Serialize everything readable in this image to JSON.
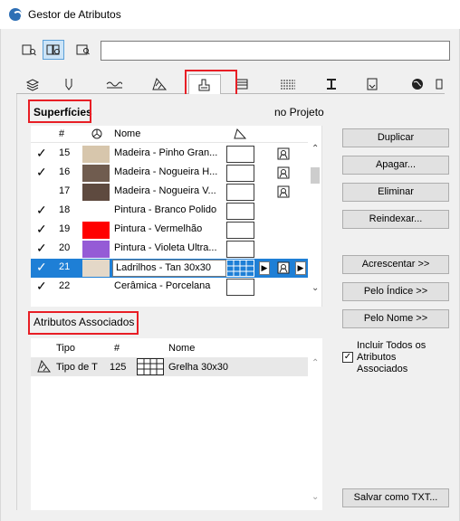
{
  "window": {
    "title": "Gestor de Atributos"
  },
  "search": {
    "value": ""
  },
  "tabs": [
    {
      "icon": "layers-icon"
    },
    {
      "icon": "pen-icon"
    },
    {
      "icon": "line-type-icon"
    },
    {
      "icon": "fill-icon"
    },
    {
      "icon": "surface-icon",
      "selected": true
    },
    {
      "icon": "composite-icon"
    },
    {
      "icon": "profile-icon"
    },
    {
      "icon": "building-material-icon"
    },
    {
      "icon": "zone-icon"
    },
    {
      "icon": "mep-icon"
    },
    {
      "icon": "globe-icon"
    }
  ],
  "surfaces": {
    "section_label": "Superfícies",
    "in_project_label": "no Projeto",
    "columns": {
      "num": "#",
      "name": "Nome"
    },
    "rows": [
      {
        "checked": true,
        "num": "15",
        "color": "#d7c6ac",
        "name": "Madeira - Pinho Gran...",
        "in_project": true
      },
      {
        "checked": true,
        "num": "16",
        "color": "#705c4f",
        "name": "Madeira - Nogueira H...",
        "in_project": true
      },
      {
        "checked": false,
        "num": "17",
        "color": "#5e4a3f",
        "name": "Madeira - Nogueira V...",
        "in_project": true
      },
      {
        "checked": true,
        "num": "18",
        "color": "#ffffff",
        "name": "Pintura - Branco Polido",
        "in_project": false
      },
      {
        "checked": true,
        "num": "19",
        "color": "#ff0000",
        "name": "Pintura - Vermelhão",
        "in_project": false
      },
      {
        "checked": true,
        "num": "20",
        "color": "#955bd6",
        "name": "Pintura - Violeta Ultra...",
        "in_project": false
      },
      {
        "checked": true,
        "num": "21",
        "color": "#e4d8c8",
        "name": "Ladrilhos - Tan 30x30",
        "in_project": true,
        "selected": true
      },
      {
        "checked": true,
        "num": "22",
        "color": "#ffffff",
        "name": "Cerâmica - Porcelana",
        "in_project": false
      }
    ]
  },
  "buttons": {
    "duplicar": "Duplicar",
    "apagar": "Apagar...",
    "eliminar": "Eliminar",
    "reindexar": "Reindexar...",
    "acrescentar": "Acrescentar >>",
    "pelo_indice": "Pelo Índice >>",
    "pelo_nome": "Pelo Nome >>",
    "salvar_txt": "Salvar como TXT..."
  },
  "associated": {
    "section_label": "Atributos Associados",
    "columns": {
      "type": "Tipo",
      "num": "#",
      "name": "Nome"
    },
    "rows": [
      {
        "type": "Tipo de T",
        "num": "125",
        "name": "Grelha 30x30"
      }
    ],
    "include_all_label": "Incluir Todos os Atributos Associados",
    "include_all_checked": true
  },
  "colors": {
    "selection": "#1e7fd6",
    "highlight": "#e81e25"
  }
}
